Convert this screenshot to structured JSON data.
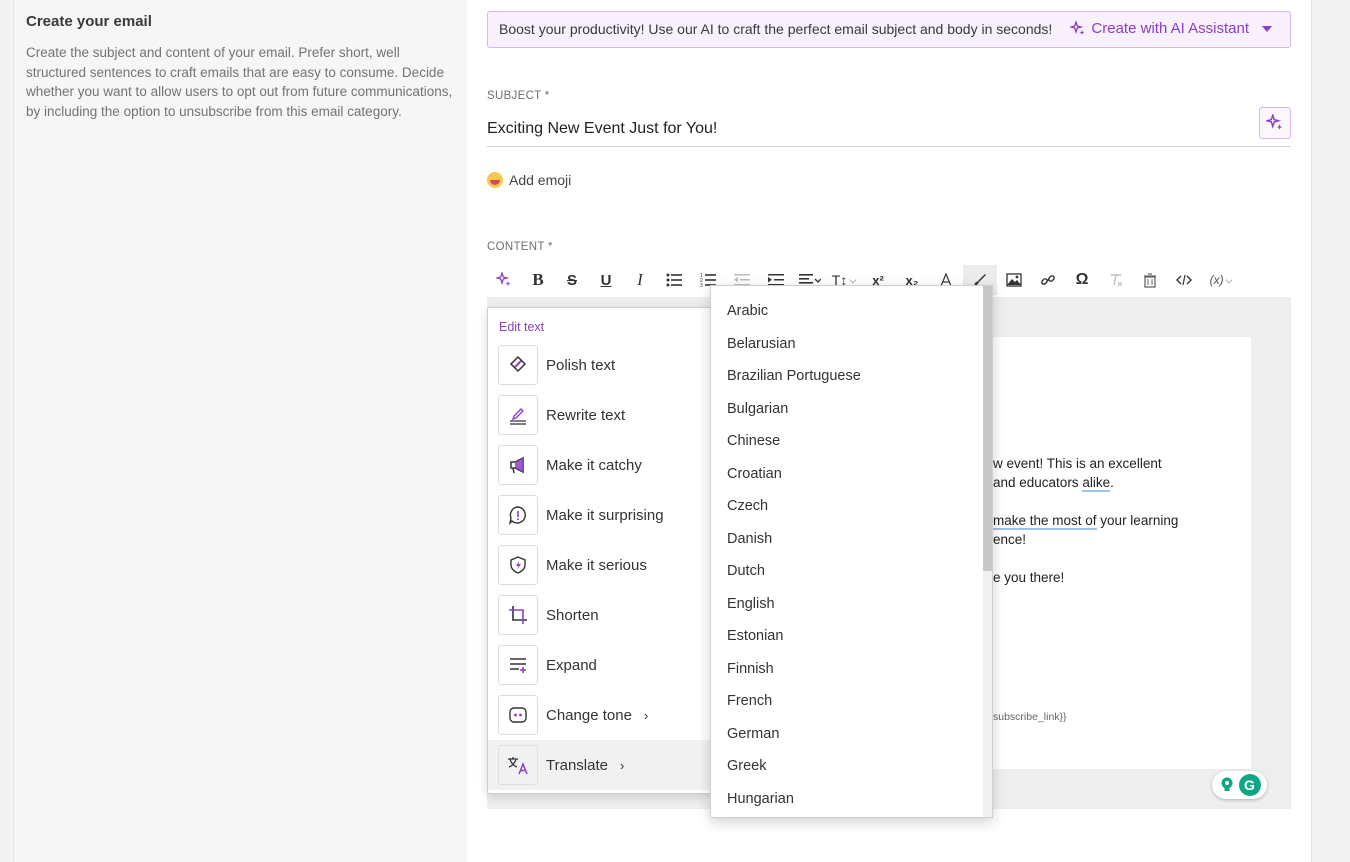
{
  "sidebar": {
    "title": "Create your email",
    "description": "Create the subject and content of your email. Prefer short, well structured sentences to craft emails that are easy to consume. Decide whether you want to allow users to opt out from future communications, by including the option to unsubscribe from this email category."
  },
  "ai_banner": {
    "message": "Boost your productivity! Use our AI to craft the perfect email subject and body in seconds!",
    "button_label": "Create with AI Assistant"
  },
  "subject": {
    "label": "SUBJECT *",
    "value": "Exciting New Event Just for You!"
  },
  "emoji": {
    "label": "Add emoji"
  },
  "content": {
    "label": "CONTENT *",
    "body_fragments": {
      "line1": "w event! This is an excellent",
      "line2a": "and educators ",
      "line2b": "alike",
      "line2c": ".",
      "line3a": "make the most of",
      "line3b": " your learning",
      "line4": "ence!",
      "line5": "e you there!",
      "line6": "subscribe_link}}"
    }
  },
  "toolbar": {
    "font_size_glyph": "T↕",
    "superscript_glyph": "x²",
    "subscript_glyph": "x₂",
    "variable_glyph": "(x)"
  },
  "edit_menu": {
    "title": "Edit text",
    "items": [
      {
        "label": "Polish text",
        "icon": "polish-icon"
      },
      {
        "label": "Rewrite text",
        "icon": "rewrite-icon"
      },
      {
        "label": "Make it catchy",
        "icon": "megaphone-icon"
      },
      {
        "label": "Make it surprising",
        "icon": "exclamation-icon"
      },
      {
        "label": "Make it serious",
        "icon": "shield-icon"
      },
      {
        "label": "Shorten",
        "icon": "crop-icon"
      },
      {
        "label": "Expand",
        "icon": "expand-icon"
      },
      {
        "label": "Change tone",
        "icon": "tone-icon"
      },
      {
        "label": "Translate",
        "icon": "translate-icon"
      }
    ]
  },
  "languages": [
    "Arabic",
    "Belarusian",
    "Brazilian Portuguese",
    "Bulgarian",
    "Chinese",
    "Croatian",
    "Czech",
    "Danish",
    "Dutch",
    "English",
    "Estonian",
    "Finnish",
    "French",
    "German",
    "Greek",
    "Hungarian"
  ],
  "colors": {
    "accent": "#8a3fc6",
    "banner_bg": "#f8f0fc",
    "grammarly": "#11a683"
  }
}
